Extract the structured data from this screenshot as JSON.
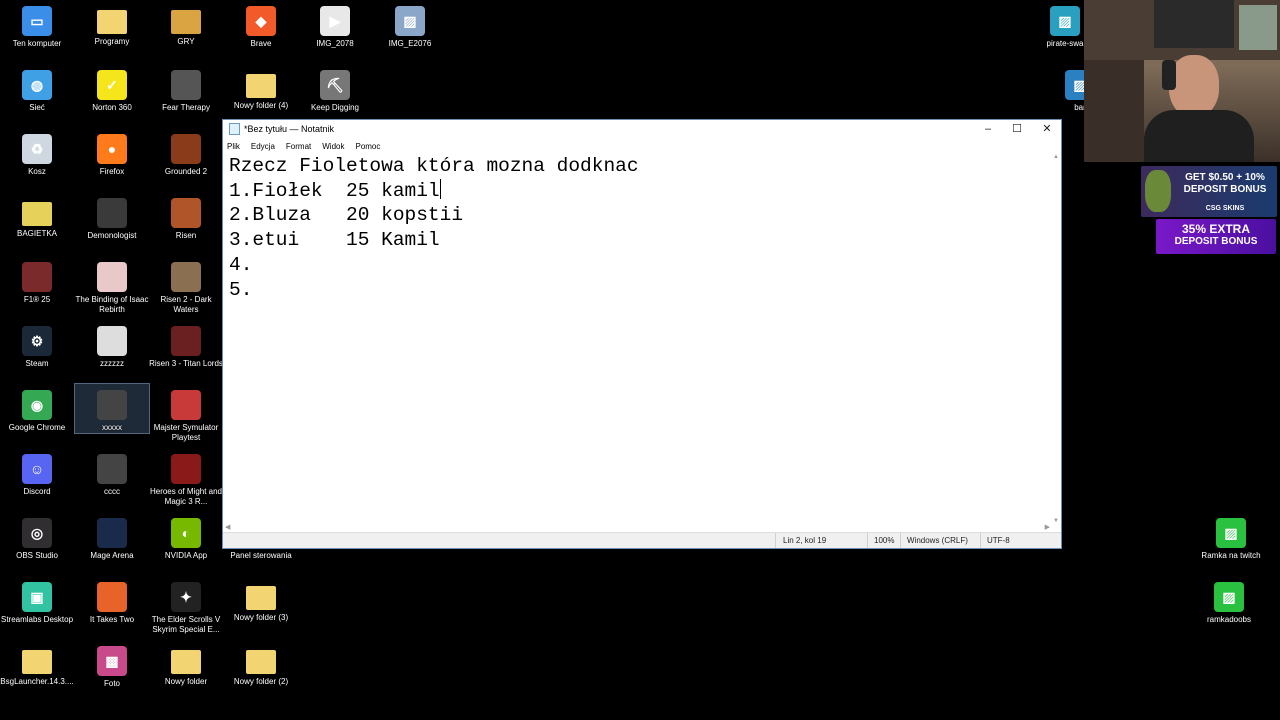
{
  "desktop": {
    "icons": [
      {
        "label": "Ten komputer",
        "icon": "computer-icon",
        "color": "#3b8ee8"
      },
      {
        "label": "Programy",
        "icon": "folder-icon",
        "color": "#f2d572"
      },
      {
        "label": "GRY",
        "icon": "folder-icon",
        "color": "#d9a441"
      },
      {
        "label": "Brave",
        "icon": "brave-icon",
        "color": "#f25a2a"
      },
      {
        "label": "IMG_2078",
        "icon": "video-file-icon",
        "color": "#e8e8e8"
      },
      {
        "label": "IMG_E2076",
        "icon": "image-file-icon",
        "color": "#8aa6c8"
      },
      {
        "label": "Sieć",
        "icon": "network-icon",
        "color": "#3fa0e6"
      },
      {
        "label": "Norton 360",
        "icon": "norton-icon",
        "color": "#f5e51b"
      },
      {
        "label": "Fear Therapy",
        "icon": "game-icon",
        "color": "#555555"
      },
      {
        "label": "Nowy folder (4)",
        "icon": "folder-icon",
        "color": "#f2d572"
      },
      {
        "label": "Keep Digging",
        "icon": "pickaxe-icon",
        "color": "#777777"
      },
      {
        "label": "Kosz",
        "icon": "recycle-bin-icon",
        "color": "#cfd8e0"
      },
      {
        "label": "Firefox",
        "icon": "firefox-icon",
        "color": "#ff7a1a"
      },
      {
        "label": "Grounded 2",
        "icon": "game-icon",
        "color": "#8a3b1a"
      },
      {
        "label": "BAGIETKA",
        "icon": "folder-icon",
        "color": "#e6d25a"
      },
      {
        "label": "Demonologist",
        "icon": "game-icon",
        "color": "#3a3a3a"
      },
      {
        "label": "Risen",
        "icon": "game-icon",
        "color": "#b0552a"
      },
      {
        "label": "F1® 25",
        "icon": "game-icon",
        "color": "#7a2a2a"
      },
      {
        "label": "The Binding of Isaac Rebirth",
        "icon": "game-icon",
        "color": "#e8c8c8"
      },
      {
        "label": "Risen 2 - Dark Waters",
        "icon": "game-icon",
        "color": "#8a7050"
      },
      {
        "label": "Steam",
        "icon": "steam-icon",
        "color": "#1b2838"
      },
      {
        "label": "zzzzzz",
        "icon": "file-icon",
        "color": "#dddddd"
      },
      {
        "label": "Risen 3 - Titan Lords",
        "icon": "game-icon",
        "color": "#6a2020"
      },
      {
        "label": "Google Chrome",
        "icon": "chrome-icon",
        "color": "#34a853"
      },
      {
        "label": "xxxxx",
        "icon": "file-icon",
        "color": "#444444"
      },
      {
        "label": "Majster Symulator Playtest",
        "icon": "game-icon",
        "color": "#c83a3a"
      },
      {
        "label": "Discord",
        "icon": "discord-icon",
        "color": "#5865f2"
      },
      {
        "label": "cccc",
        "icon": "file-icon",
        "color": "#444444"
      },
      {
        "label": "Heroes of Might and Magic 3 R...",
        "icon": "game-icon",
        "color": "#8a1a1a"
      },
      {
        "label": "OBS Studio",
        "icon": "obs-icon",
        "color": "#302e31"
      },
      {
        "label": "Mage Arena",
        "icon": "game-icon",
        "color": "#1a2a4a"
      },
      {
        "label": "NVIDIA App",
        "icon": "nvidia-icon",
        "color": "#76b900"
      },
      {
        "label": "Panel sterowania",
        "icon": "control-panel-icon",
        "color": "#000000"
      },
      {
        "label": "Streamlabs Desktop",
        "icon": "streamlabs-icon",
        "color": "#31c3a2"
      },
      {
        "label": "It Takes Two",
        "icon": "game-icon",
        "color": "#e8632a"
      },
      {
        "label": "The Elder Scrolls V Skyrim Special E...",
        "icon": "skyrim-icon",
        "color": "#222222"
      },
      {
        "label": "Nowy folder (3)",
        "icon": "folder-icon",
        "color": "#f2d572"
      },
      {
        "label": "BsgLauncher.14.3....",
        "icon": "folder-icon",
        "color": "#f2d572"
      },
      {
        "label": "Foto",
        "icon": "photos-icon",
        "color": "#c84a8a"
      },
      {
        "label": "Nowy folder",
        "icon": "folder-icon",
        "color": "#f2d572"
      },
      {
        "label": "Nowy folder (2)",
        "icon": "folder-icon",
        "color": "#f2d572"
      },
      {
        "label": "pirate-swa",
        "icon": "image-file-icon",
        "color": "#2aa0c0"
      },
      {
        "label": "bar",
        "icon": "image-file-icon",
        "color": "#2a80c0"
      },
      {
        "label": "Ramka na twitch",
        "icon": "image-file-icon",
        "color": "#2ac040"
      },
      {
        "label": "ramkadoobs",
        "icon": "image-file-icon",
        "color": "#2ac040"
      }
    ]
  },
  "notepad": {
    "title": "*Bez tytułu — Notatnik",
    "menu": [
      "Plik",
      "Edycja",
      "Format",
      "Widok",
      "Pomoc"
    ],
    "lines": [
      "Rzecz Fioletowa która mozna dodknac",
      "1.Fiołek  25 kamil",
      "2.Bluza   20 kopstii",
      "3.etui    15 Kamil",
      "4.",
      "5."
    ],
    "status": {
      "position": "Lin 2, kol 19",
      "zoom": "100%",
      "line_ending": "Windows (CRLF)",
      "encoding": "UTF-8"
    }
  },
  "ads": {
    "ad1_line1": "GET $0.50 + 10%",
    "ad1_line2": "DEPOSIT BONUS",
    "ad1_brand": "CSG SKINS",
    "ad2_line1": "35% EXTRA",
    "ad2_line2": "DEPOSIT BONUS"
  }
}
